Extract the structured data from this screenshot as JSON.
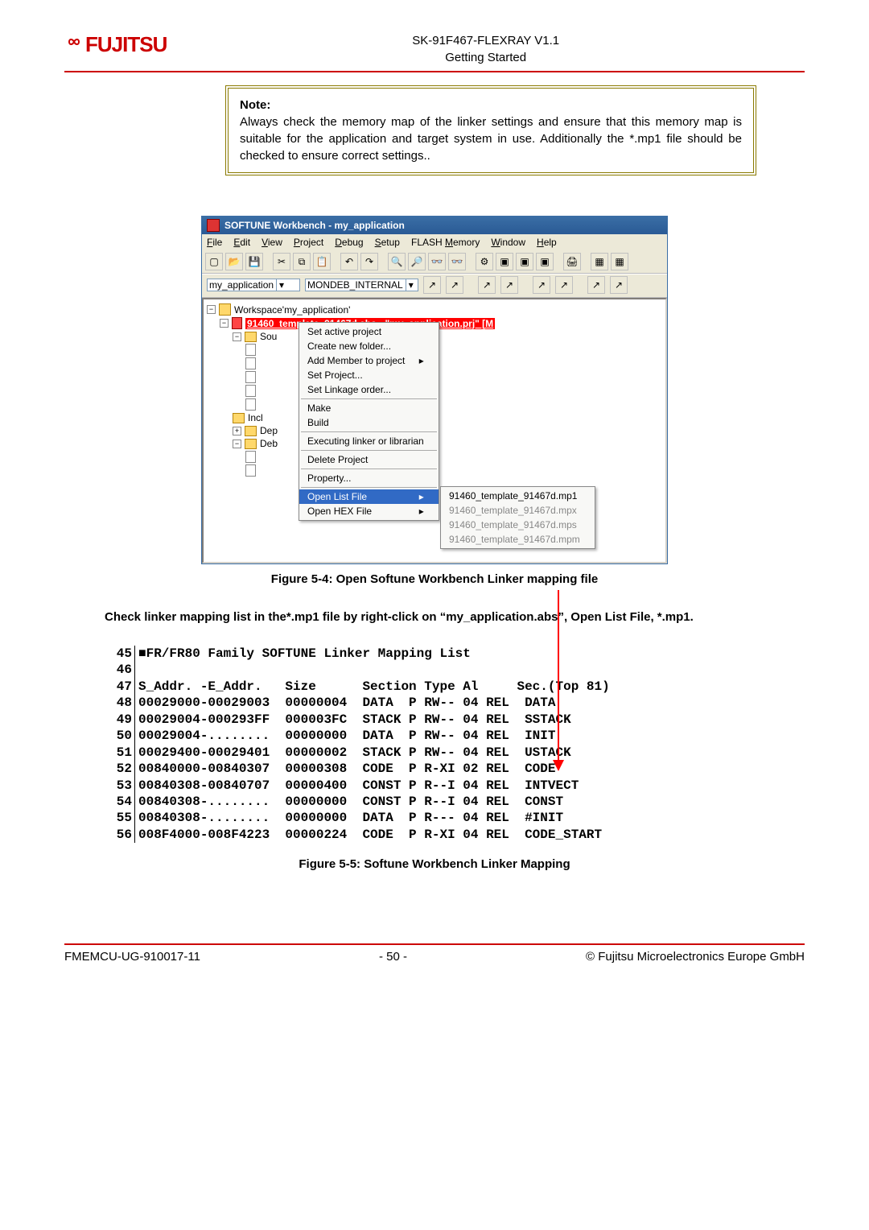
{
  "header": {
    "doc_title": "SK-91F467-FLEXRAY V1.1",
    "doc_subtitle": "Getting Started",
    "logo_text": "FUJITSU"
  },
  "note": {
    "title": "Note:",
    "body": "Always check the memory map of the linker settings and ensure that this memory map is suitable for the application and target system in use. Additionally the *.mp1 file should be checked to ensure correct settings.."
  },
  "softune": {
    "title": "SOFTUNE Workbench - my_application",
    "menus": [
      "File",
      "Edit",
      "View",
      "Project",
      "Debug",
      "Setup",
      "FLASH Memory",
      "Window",
      "Help"
    ],
    "select_project": "my_application",
    "select_config": "MONDEB_INTERNAL",
    "tree": {
      "workspace": "Workspace'my_application'",
      "project": "91460_template_91467d.abs - \"my_application.prj\" [M",
      "nodes": [
        "Sou",
        "Incl",
        "Dep",
        "Deb"
      ]
    },
    "ctx": {
      "items": [
        "Set active project",
        "Create new folder...",
        "Add Member to project",
        "Set Project...",
        "Set Linkage order...",
        "Make",
        "Build",
        "Executing linker or librarian",
        "Delete Project",
        "Property...",
        "Open List File",
        "Open HEX File"
      ]
    },
    "sublist": [
      "91460_template_91467d.mp1",
      "91460_template_91467d.mpx",
      "91460_template_91467d.mps",
      "91460_template_91467d.mpm"
    ]
  },
  "fig1_caption": "Figure 5-4: Open Softune Workbench Linker mapping file",
  "body_text": "Check linker mapping list in the*.mp1 file by right-click on “my_application.abs”, Open List File, *.mp1.",
  "chart_data": {
    "type": "table",
    "title": "FR/FR80 Family SOFTUNE Linker Mapping List",
    "header": "S_Addr. -E_Addr.   Size      Section Type Al     Sec.(Top 81)",
    "rows": [
      {
        "line": 48,
        "s": "00029000",
        "e": "00029003",
        "size": "00000004",
        "section": "DATA",
        "p": "P",
        "type": "RW--",
        "al": "04",
        "rel": "REL",
        "sec": "DATA"
      },
      {
        "line": 49,
        "s": "00029004",
        "e": "000293FF",
        "size": "000003FC",
        "section": "STACK",
        "p": "P",
        "type": "RW--",
        "al": "04",
        "rel": "REL",
        "sec": "SSTACK"
      },
      {
        "line": 50,
        "s": "00029004",
        "e": "........",
        "size": "00000000",
        "section": "DATA",
        "p": "P",
        "type": "RW--",
        "al": "04",
        "rel": "REL",
        "sec": "INIT"
      },
      {
        "line": 51,
        "s": "00029400",
        "e": "00029401",
        "size": "00000002",
        "section": "STACK",
        "p": "P",
        "type": "RW--",
        "al": "04",
        "rel": "REL",
        "sec": "USTACK"
      },
      {
        "line": 52,
        "s": "00840000",
        "e": "00840307",
        "size": "00000308",
        "section": "CODE",
        "p": "P",
        "type": "R-XI",
        "al": "02",
        "rel": "REL",
        "sec": "CODE"
      },
      {
        "line": 53,
        "s": "00840308",
        "e": "00840707",
        "size": "00000400",
        "section": "CONST",
        "p": "P",
        "type": "R--I",
        "al": "04",
        "rel": "REL",
        "sec": "INTVECT"
      },
      {
        "line": 54,
        "s": "00840308",
        "e": "........",
        "size": "00000000",
        "section": "CONST",
        "p": "P",
        "type": "R--I",
        "al": "04",
        "rel": "REL",
        "sec": "CONST"
      },
      {
        "line": 55,
        "s": "00840308",
        "e": "........",
        "size": "00000000",
        "section": "DATA",
        "p": "P",
        "type": "R---",
        "al": "04",
        "rel": "REL",
        "sec": "#INIT"
      },
      {
        "line": 56,
        "s": "008F4000",
        "e": "008F4223",
        "size": "00000224",
        "section": "CODE",
        "p": "P",
        "type": "R-XI",
        "al": "04",
        "rel": "REL",
        "sec": "CODE_START"
      }
    ]
  },
  "fig2_caption": "Figure 5-5: Softune Workbench Linker Mapping",
  "footer": {
    "left": "FMEMCU-UG-910017-11",
    "center": "- 50 -",
    "right": "© Fujitsu Microelectronics Europe GmbH"
  }
}
